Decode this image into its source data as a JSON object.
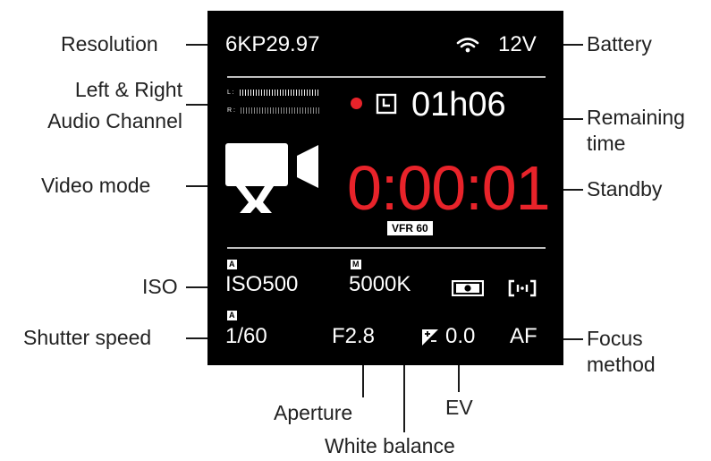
{
  "callouts": {
    "resolution": "Resolution",
    "battery": "Battery",
    "audio_line1": "Left & Right",
    "audio_line2": "Audio Channel",
    "remaining_line1": "Remaining",
    "remaining_line2": "time",
    "video_mode": "Video mode",
    "standby": "Standby",
    "iso": "ISO",
    "shutter": "Shutter speed",
    "focus_line1": "Focus",
    "focus_line2": "method",
    "aperture": "Aperture",
    "ev": "EV",
    "white_balance": "White balance"
  },
  "screen": {
    "resolution": "6KP29.97",
    "battery": "12V",
    "meter_left_label": "L :",
    "meter_right_label": "R :",
    "remaining_time": "01h06",
    "timecode": "0:00:01",
    "frame_rate_tag": "VFR 60",
    "iso_mode": "A",
    "iso": "ISO500",
    "wb_mode": "M",
    "white_balance": "5000K",
    "shutter_mode": "A",
    "shutter": "1/60",
    "aperture": "F2.8",
    "ev": "0.0",
    "focus": "AF"
  },
  "icons": [
    "wifi-icon",
    "record-dot-icon",
    "clock-icon",
    "video-camera-icon",
    "metering-icon",
    "focus-area-icon",
    "exposure-comp-icon"
  ],
  "colors": {
    "screen_bg": "#000000",
    "text": "#ffffff",
    "timecode": "#e8232a",
    "record_dot": "#e8232a",
    "divider": "#bfbfbf"
  }
}
